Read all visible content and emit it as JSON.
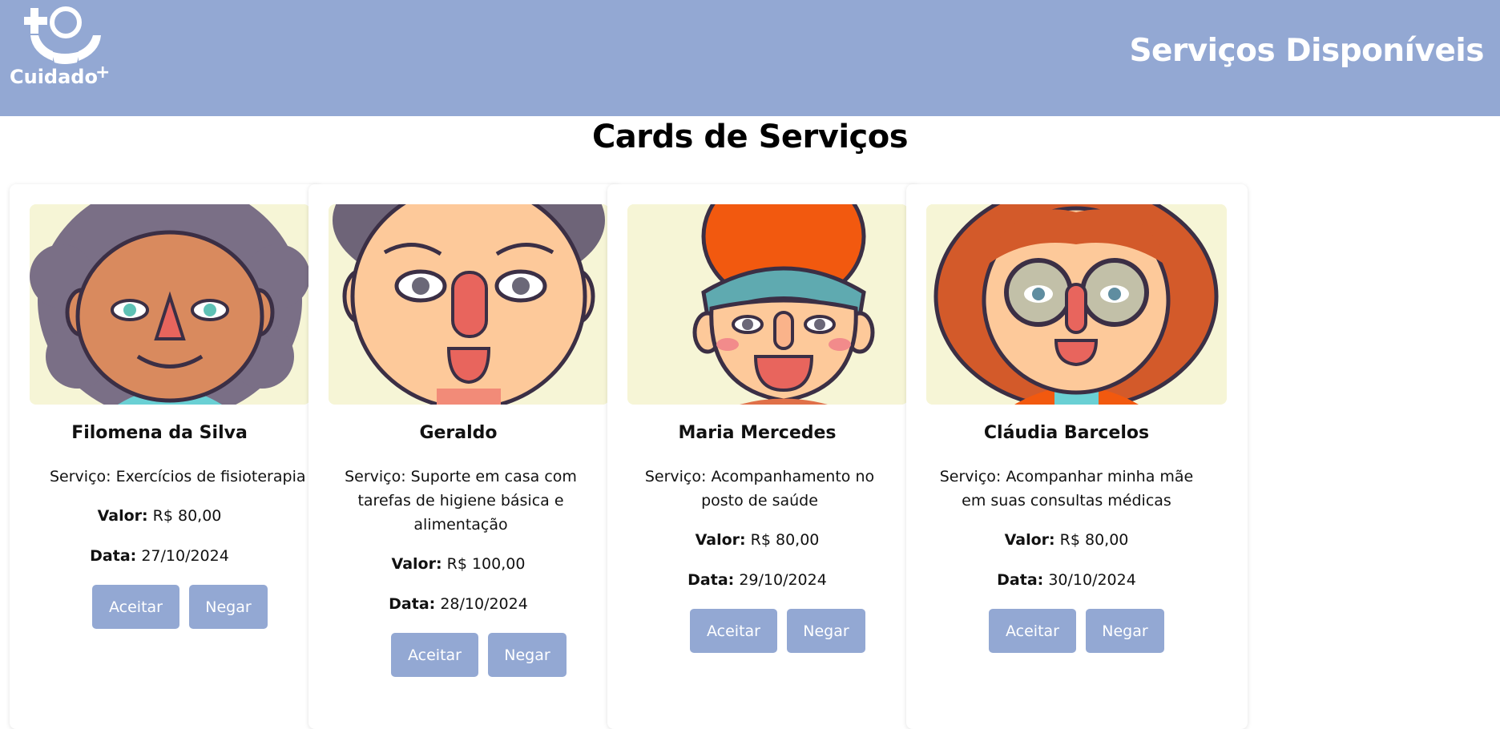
{
  "header": {
    "logo_text": "Cuidado",
    "logo_plus": "+",
    "title": "Serviços Disponíveis",
    "bg_color": "#93a8d3"
  },
  "page": {
    "section_title": "Cards de Serviços"
  },
  "labels": {
    "service_prefix": "Serviço: ",
    "value_label": "Valor:",
    "date_label": "Data:",
    "accept_button": "Aceitar",
    "deny_button": "Negar"
  },
  "cards": [
    {
      "name": "Filomena da Silva",
      "service": "Serviço: Exercícios de fisioterapia",
      "value": "R$ 80,00",
      "date": "27/10/2024",
      "avatar_icon": "woman-curly-gray-hair-avatar"
    },
    {
      "name": "Geraldo",
      "service": "Serviço: Suporte em casa com tarefas de higiene básica e alimentação",
      "value": "R$ 100,00",
      "date": "28/10/2024",
      "avatar_icon": "man-gray-hair-avatar"
    },
    {
      "name": "Maria Mercedes",
      "service": "Serviço: Acompanhamento no posto de saúde",
      "value": "R$ 80,00",
      "date": "29/10/2024",
      "avatar_icon": "woman-beanie-headband-avatar"
    },
    {
      "name": "Cláudia Barcelos",
      "service": "Serviço: Acompanhar minha mãe em suas consultas médicas",
      "value": "R$ 80,00",
      "date": "30/10/2024",
      "avatar_icon": "woman-red-hair-glasses-avatar"
    }
  ]
}
